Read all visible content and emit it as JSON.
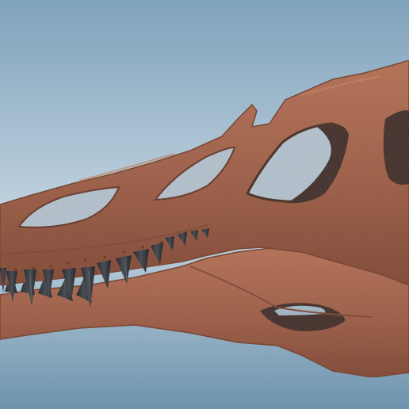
{
  "scene": {
    "subject": "skull-model-render",
    "colors": {
      "sky_top": "#8fb0c6",
      "sky_bottom": "#c7d7e2",
      "bone": "#a2624a",
      "bone_light": "#bf7f63",
      "bone_dark": "#6e3a28",
      "fenestra_shadow": "#1e1c20",
      "tooth": "#2d2f33",
      "tooth_tip": "#4a4d52"
    }
  }
}
